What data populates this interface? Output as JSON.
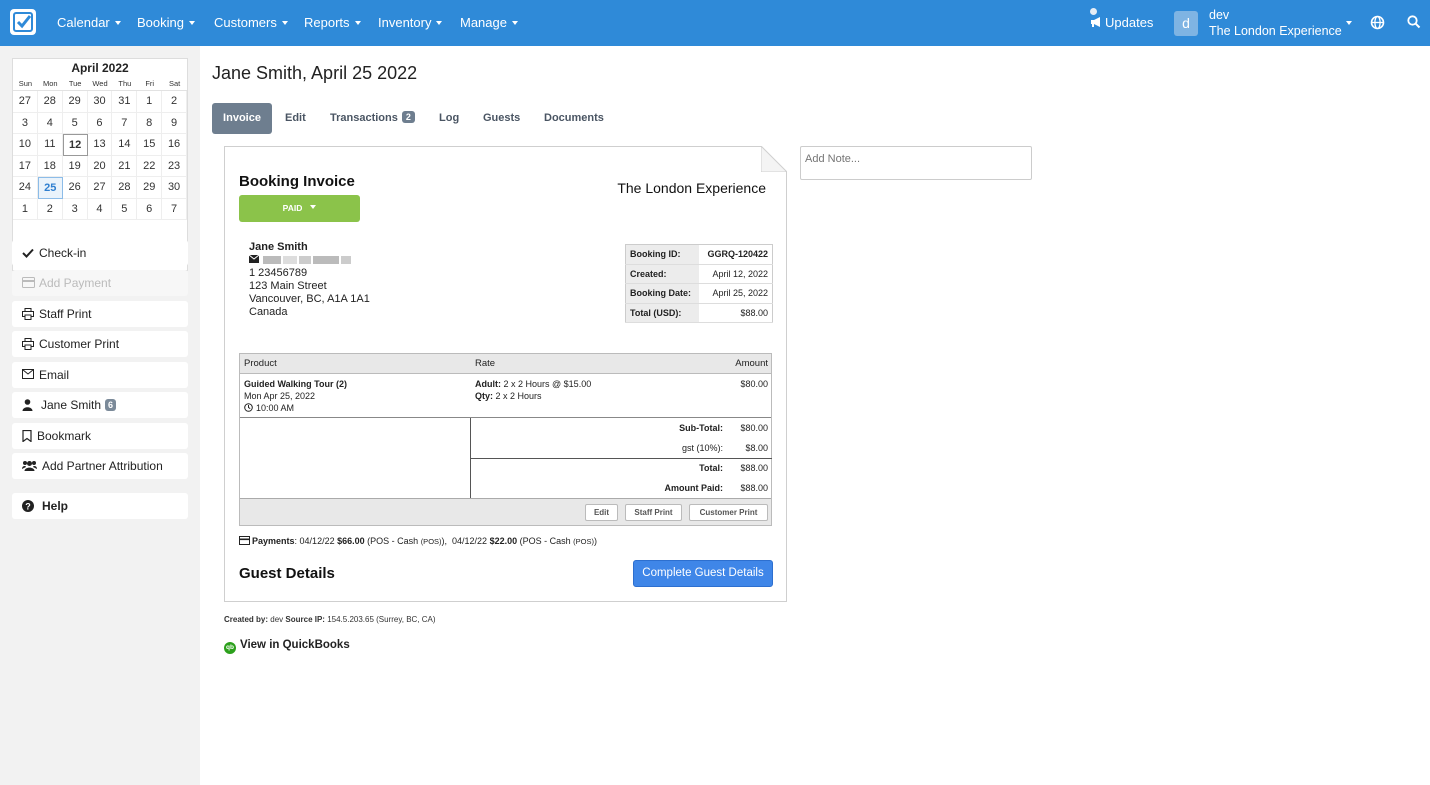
{
  "nav": {
    "items": [
      "Calendar",
      "Booking",
      "Customers",
      "Reports",
      "Inventory",
      "Manage"
    ],
    "updates": "Updates",
    "avatar_letter": "d",
    "user_name": "dev",
    "company": "The London Experience",
    "brand_color": "#2f8ad8"
  },
  "calendar": {
    "title": "April 2022",
    "dow": [
      "Sun",
      "Mon",
      "Tue",
      "Wed",
      "Thu",
      "Fri",
      "Sat"
    ],
    "days": [
      "27",
      "28",
      "29",
      "30",
      "31",
      "1",
      "2",
      "3",
      "4",
      "5",
      "6",
      "7",
      "8",
      "9",
      "10",
      "11",
      "12",
      "13",
      "14",
      "15",
      "16",
      "17",
      "18",
      "19",
      "20",
      "21",
      "22",
      "23",
      "24",
      "25",
      "26",
      "27",
      "28",
      "29",
      "30",
      "1",
      "2",
      "3",
      "4",
      "5",
      "6",
      "7"
    ],
    "today": "12",
    "selected": "25"
  },
  "sidebar": {
    "checkin": "Check-in",
    "add_payment": "Add Payment",
    "staff_print": "Staff Print",
    "customer_print": "Customer Print",
    "email": "Email",
    "customer": "Jane Smith",
    "customer_count": "6",
    "bookmark": "Bookmark",
    "partner": "Add Partner Attribution",
    "help": "Help"
  },
  "page": {
    "title": "Jane Smith, April 25 2022",
    "tabs": [
      "Invoice",
      "Edit",
      "Transactions",
      "Log",
      "Guests",
      "Documents"
    ],
    "transactions_count": "2",
    "note_placeholder": "Add Note..."
  },
  "invoice": {
    "title": "Booking Invoice",
    "status": "PAID",
    "company": "The London Experience",
    "customer": {
      "name": "Jane Smith",
      "phone": "1 23456789",
      "address1": "123 Main Street",
      "address2": "Vancouver, BC, A1A 1A1",
      "country": "Canada"
    },
    "meta": [
      {
        "label": "Booking ID:",
        "value": "GGRQ-120422"
      },
      {
        "label": "Created:",
        "value": "April 12, 2022"
      },
      {
        "label": "Booking Date:",
        "value": "April 25, 2022"
      },
      {
        "label": "Total (USD):",
        "value": "$88.00"
      }
    ],
    "headers": {
      "product": "Product",
      "rate": "Rate",
      "amount": "Amount"
    },
    "item": {
      "name": "Guided Walking Tour (2)",
      "date": "Mon Apr 25, 2022",
      "time": "10:00 AM",
      "rate_label": "Adult:",
      "rate_value": "2 x 2 Hours @ $15.00",
      "qty_label": "Qty:",
      "qty_value": "2 x 2 Hours",
      "amount": "$80.00"
    },
    "totals": [
      {
        "label": "Sub-Total:",
        "value": "$80.00",
        "bold": true
      },
      {
        "label": "gst (10%):",
        "value": "$8.00",
        "bold": false
      },
      {
        "label": "Total:",
        "value": "$88.00",
        "bold": true
      },
      {
        "label": "Amount Paid:",
        "value": "$88.00",
        "bold": true
      }
    ],
    "buttons": {
      "edit": "Edit",
      "staff_print": "Staff Print",
      "customer_print": "Customer Print"
    },
    "payments": {
      "label": "Payments",
      "p1_date": "04/12/22",
      "p1_amount": "$66.00",
      "p1_method": "(POS - Cash",
      "p1_tag": "(POS)",
      "p2_date": "04/12/22",
      "p2_amount": "$22.00",
      "p2_method": "(POS - Cash",
      "p2_tag": "(POS)"
    },
    "guest_title": "Guest Details",
    "guest_button": "Complete Guest Details"
  },
  "footer": {
    "created_label": "Created by:",
    "created_by": "dev",
    "ip_label": "Source IP:",
    "ip": "154.5.203.65 (Surrey, BC, CA)",
    "quickbooks": "View in QuickBooks",
    "qb_icon_text": "qb"
  }
}
